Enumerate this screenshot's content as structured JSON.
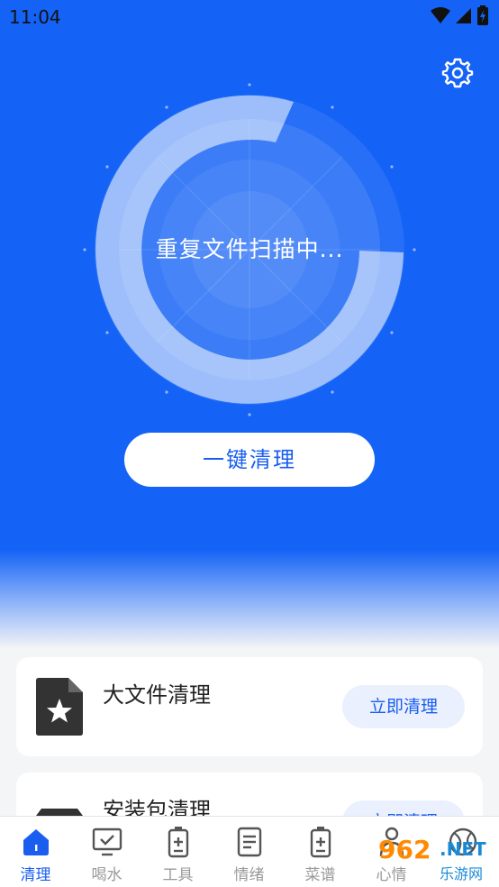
{
  "status_bar": {
    "time": "11:04"
  },
  "scan": {
    "status_text": "重复文件扫描中..."
  },
  "actions": {
    "one_click_clean": "一键清理"
  },
  "cards": [
    {
      "title": "大文件清理",
      "button": "立即清理",
      "icon": "star-file-icon"
    },
    {
      "title": "安装包清理",
      "button": "立即清理",
      "icon": "package-box-icon"
    }
  ],
  "tabs": [
    {
      "label": "清理",
      "icon": "home-icon",
      "active": true
    },
    {
      "label": "喝水",
      "icon": "monitor-check-icon",
      "active": false
    },
    {
      "label": "工具",
      "icon": "battery-plus-icon",
      "active": false
    },
    {
      "label": "情绪",
      "icon": "document-lines-icon",
      "active": false
    },
    {
      "label": "菜谱",
      "icon": "battery-plus-icon",
      "active": false
    },
    {
      "label": "心情",
      "icon": "person-icon",
      "active": false
    },
    {
      "label": "",
      "icon": "ball-icon",
      "active": false
    }
  ],
  "watermark": {
    "number": "962",
    "suffix": ".NET",
    "chinese": "乐游网"
  },
  "colors": {
    "primary": "#1463f6",
    "accent": "#1a5ef0",
    "button_bg": "#eaf0fd"
  }
}
